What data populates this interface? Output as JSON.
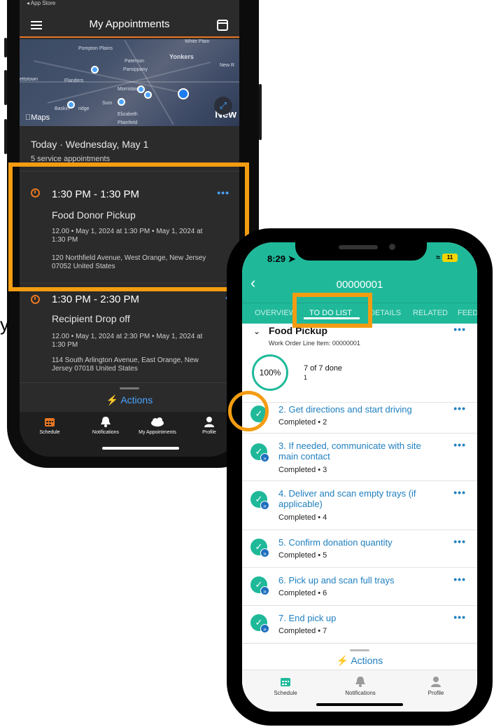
{
  "back_phone": {
    "status_text": "◂ App Store",
    "header_title": "My Appointments",
    "map": {
      "towns": [
        "Pompton Plains",
        "White Plain",
        "Paterson",
        "Yonkers",
        "Parsippany",
        "New R",
        "ettstown",
        "Flanders",
        "Morristown",
        "Baskin",
        "ridge",
        "Sum",
        "Elizabeth",
        "Plainfield"
      ],
      "maps_label": "Maps",
      "big_city": "New"
    },
    "date_line": "Today · Wednesday, May 1",
    "count_line": "5 service appointments",
    "appointments": [
      {
        "time": "1:30 PM - 1:30 PM",
        "name": "Food Donor Pickup",
        "detail": "12.00 • May 1, 2024 at 1:30 PM • May 1, 2024 at 1:30 PM",
        "address": "120 Northfield Avenue, West Orange, New Jersey 07052 United States",
        "more": "•••"
      },
      {
        "time": "1:30 PM - 2:30 PM",
        "name": "Recipient Drop off",
        "detail": "12.00 • May 1, 2024 at 2:30 PM • May 1, 2024 at 1:30 PM",
        "address": "114 South Arlington Avenue, East Orange, New Jersey 07018 United States",
        "more": "•"
      }
    ],
    "actions_label": "Actions",
    "tabs": [
      "Schedule",
      "Notifications",
      "My Appointments",
      "Profile"
    ]
  },
  "front_phone": {
    "clock": "8:29",
    "battery": "11",
    "title": "00000001",
    "tabs": [
      "OVERVIEW",
      "TO DO LIST",
      "DETAILS",
      "RELATED",
      "FEED"
    ],
    "active_tab": "TO DO LIST",
    "section": {
      "title": "Food Pickup",
      "subtitle": "Work Order Line Item: 00000001",
      "progress_percent": "100%",
      "progress_done": "7 of 7 done",
      "progress_count": "1"
    },
    "tasks": [
      {
        "title": "2. Get directions and start driving",
        "status": "Completed • 2"
      },
      {
        "title": "3. If needed, communicate with site main contact",
        "status": "Completed • 3"
      },
      {
        "title": "4. Deliver and scan empty trays (if applicable)",
        "status": "Completed • 4"
      },
      {
        "title": "5. Confirm donation quantity",
        "status": "Completed • 5"
      },
      {
        "title": "6. Pick up and scan full trays",
        "status": "Completed • 6"
      },
      {
        "title": "7. End pick up",
        "status": "Completed • 7"
      }
    ],
    "more": "•••",
    "actions_label": "Actions",
    "bottom_tabs": [
      "Schedule",
      "Notifications",
      "Profile"
    ]
  },
  "stray_glyph": "y",
  "colors": {
    "accent_orange": "#e87722",
    "highlight": "#f39c12",
    "teal": "#1fb99a",
    "link_blue": "#1f7fbf"
  }
}
